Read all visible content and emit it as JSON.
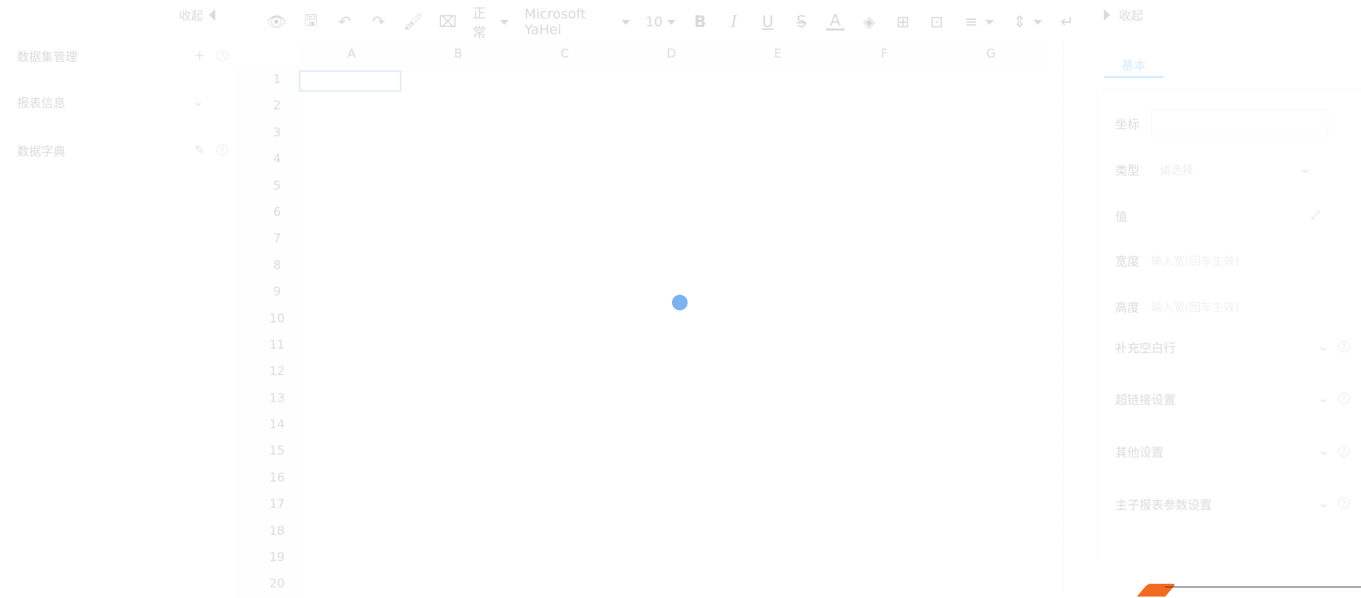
{
  "left_panel": {
    "collapse_label": "收起",
    "dataset": "数据集管理",
    "report_info": "报表信息",
    "dictionary": "数据字典",
    "help": "?"
  },
  "toolbar": {
    "style_select": "正常",
    "font_select": "Microsoft YaHei",
    "size_select": "10",
    "bold": "B",
    "italic": "I",
    "underline": "U",
    "strike": "S",
    "font_color": "A"
  },
  "grid": {
    "columns": [
      "A",
      "B",
      "C",
      "D",
      "E",
      "F",
      "G"
    ],
    "rows": [
      "1",
      "2",
      "3",
      "4",
      "5",
      "6",
      "7",
      "8",
      "9",
      "10",
      "11",
      "12",
      "13",
      "14",
      "15",
      "16",
      "17",
      "18",
      "19",
      "20"
    ]
  },
  "right_panel": {
    "collapse_label": "收起",
    "tab_basic": "基本",
    "coord_label": "坐标",
    "coord_value": "",
    "type_label": "类型",
    "type_value": "请选择",
    "value_label": "值",
    "width_label": "宽度",
    "width_placeholder": "输入宽(回车生效)",
    "height_label": "高度",
    "height_placeholder": "输入宽(回车生效)",
    "sections": [
      "补充空白行",
      "超链接设置",
      "其他设置",
      "主子报表参数设置"
    ]
  }
}
